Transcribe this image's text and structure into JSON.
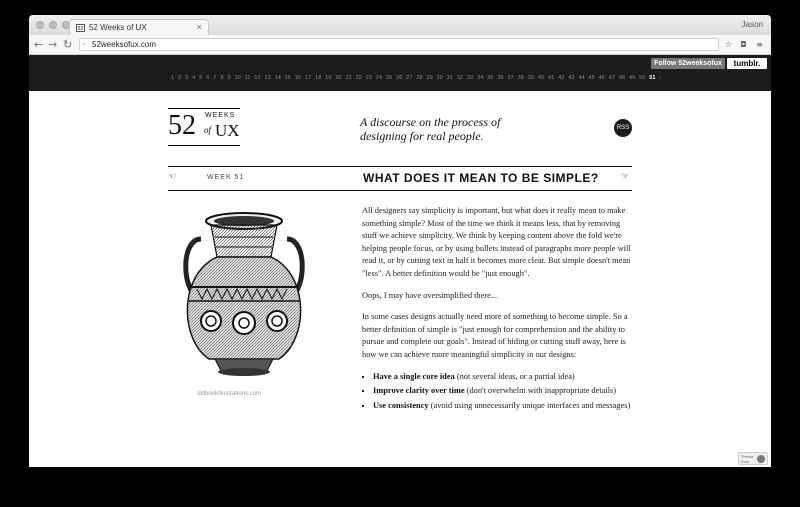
{
  "browser": {
    "tab_title": "52 Weeks of UX",
    "favicon": "52",
    "user": "Jason",
    "url": "52weeksofux.com"
  },
  "sitebar": {
    "follow_label": "Follow 52weeksofux",
    "tumblr_label": "tumblr.",
    "weeks": [
      "1",
      "2",
      "3",
      "4",
      "5",
      "6",
      "7",
      "8",
      "9",
      "10",
      "11",
      "12",
      "13",
      "14",
      "15",
      "16",
      "17",
      "18",
      "19",
      "20",
      "21",
      "22",
      "23",
      "24",
      "25",
      "26",
      "27",
      "28",
      "29",
      "30",
      "31",
      "32",
      "33",
      "34",
      "35",
      "36",
      "37",
      "38",
      "39",
      "40",
      "41",
      "42",
      "43",
      "44",
      "45",
      "46",
      "47",
      "48",
      "49",
      "50",
      "51"
    ],
    "current_week": "51",
    "next": "›"
  },
  "header": {
    "logo_number": "52",
    "logo_weeks": "WEEKS",
    "logo_of": "of",
    "logo_ux": "UX",
    "tagline": "A discourse on the process of designing for real people.",
    "rss": "RSS"
  },
  "post": {
    "week_label": "WEEK 51",
    "title": "WHAT DOES IT MEAN TO BE SIMPLE?",
    "image_caption": "oldbookillustrations.com",
    "paragraphs": [
      "All designers say simplicity is important, but what does it really mean to make something simple? Most of the time we think it means less, that by removing stuff we achieve simplicity. We think by keeping content above the fold we're helping people focus, or by using bullets instead of paragraphs more people will read it, or by cutting text in half it becomes more clear. But simple doesn't mean \"less\". A better definition would be \"just enough\".",
      "Oops, I may have oversimplified there...",
      "In some cases designs actually need more of something to become simple. So a better definition of simple is \"just enough for comprehension and the ability to pursue and complete our goals\". Instead of hiding or cutting stuff away, here is how we can achieve more meaningful simplicity in our designs:"
    ],
    "bullets": [
      {
        "strong": "Have a single core idea",
        "rest": " (not several ideas, or a partial idea)"
      },
      {
        "strong": "Improve clarity over time",
        "rest": " (don't overwhelm with inappropriate details)"
      },
      {
        "strong": "Use consistency",
        "rest": " (avoid using unnecessarily unique interfaces and messages)"
      }
    ]
  },
  "badge": {
    "line1": "Theme",
    "line2": "from"
  }
}
